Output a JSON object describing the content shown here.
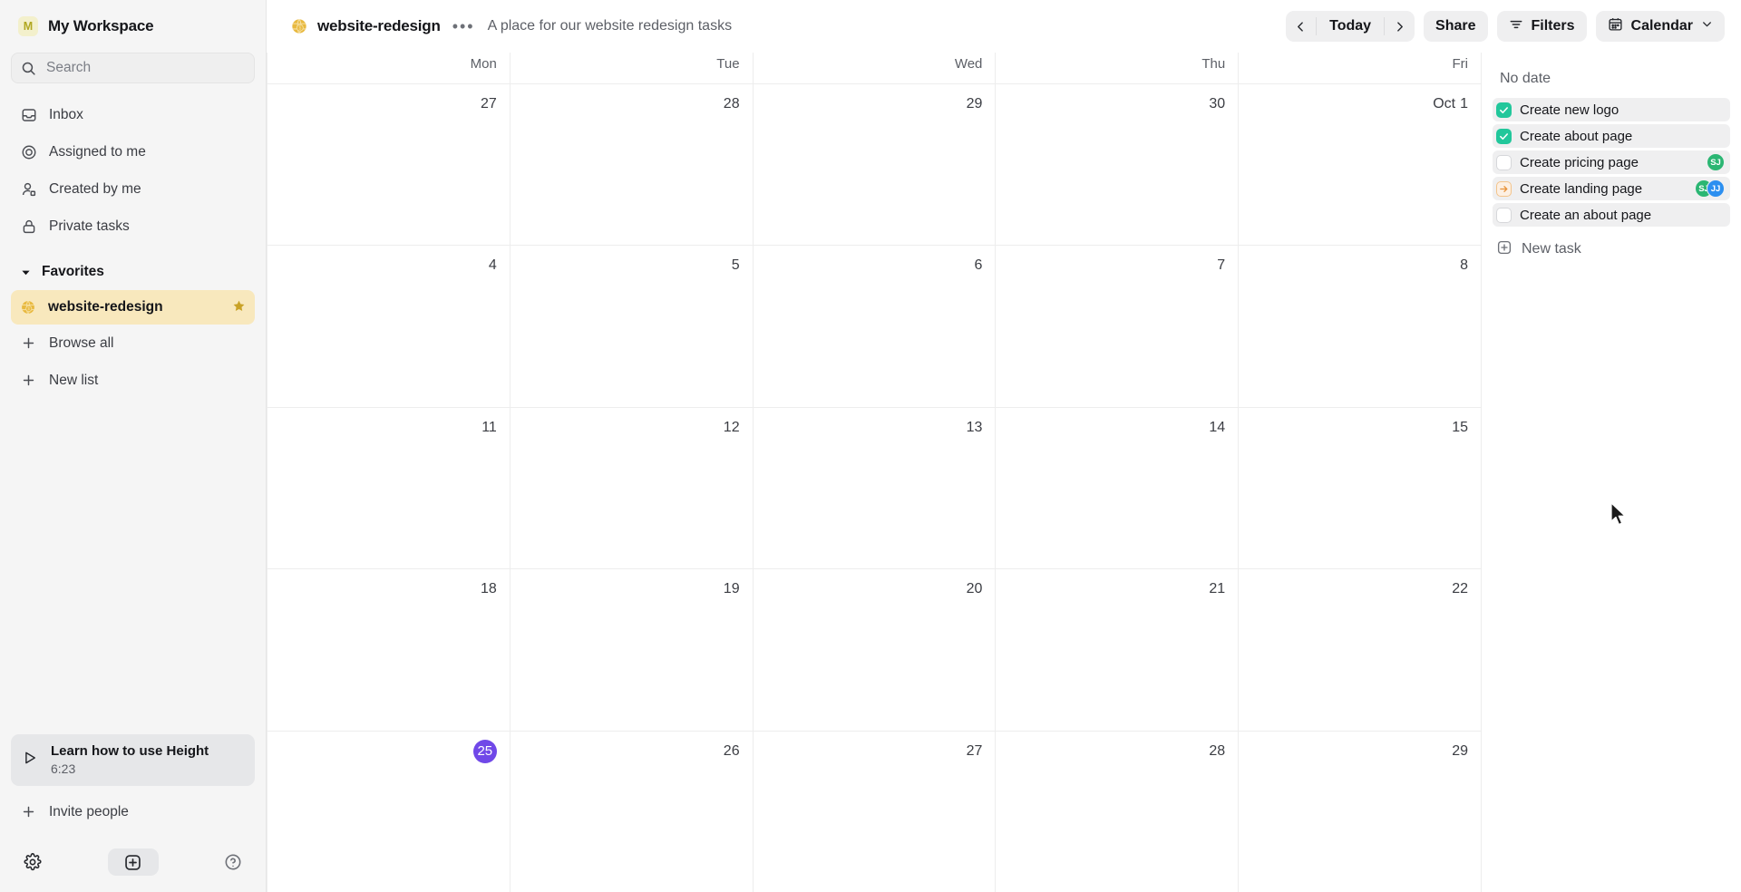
{
  "sidebar": {
    "workspace": {
      "avatar_initial": "M",
      "name": "My Workspace",
      "avatar_bg": "#f3f0cc",
      "avatar_fg": "#b0a721"
    },
    "search": {
      "placeholder": "Search",
      "value": "",
      "icon": "search-icon"
    },
    "nav": [
      {
        "icon": "inbox-icon",
        "label": "Inbox"
      },
      {
        "icon": "target-icon",
        "label": "Assigned to me"
      },
      {
        "icon": "user-icon",
        "label": "Created by me"
      },
      {
        "icon": "lock-icon",
        "label": "Private tasks"
      }
    ],
    "favorites": {
      "caret": "chevron-down-icon",
      "title": "Favorites"
    },
    "favorite_items": [
      {
        "icon": "globe-icon",
        "name": "website-redesign",
        "starred": true,
        "star_icon": "star-icon",
        "active": true
      }
    ],
    "actions": [
      {
        "icon": "plus-icon",
        "label": "Browse all"
      },
      {
        "icon": "plus-icon",
        "label": "New list"
      }
    ],
    "learn_card": {
      "icon": "play-icon",
      "title": "Learn how to use Height",
      "duration": "6:23"
    },
    "invite": {
      "icon": "plus-icon",
      "label": "Invite people"
    },
    "bottom": {
      "settings_icon": "gear-icon",
      "add_icon": "plus-square-icon",
      "help_icon": "help-circle-icon"
    }
  },
  "topbar": {
    "doc_icon": "globe-icon",
    "title": "website-redesign",
    "more_label": "•••",
    "description": "A place for our website redesign tasks",
    "nav": {
      "prev_icon": "chevron-left-icon",
      "today_label": "Today",
      "next_icon": "chevron-right-icon"
    },
    "share_label": "Share",
    "filters": {
      "icon": "filter-icon",
      "label": "Filters"
    },
    "view": {
      "icon": "calendar-icon",
      "label": "Calendar",
      "caret": "chevron-down-icon"
    }
  },
  "calendar": {
    "weekday_headers": [
      "Mon",
      "Tue",
      "Wed",
      "Thu",
      "Fri"
    ],
    "today_color": "#7048e8",
    "weeks": [
      [
        {
          "day": "27",
          "month": ""
        },
        {
          "day": "28",
          "month": ""
        },
        {
          "day": "29",
          "month": ""
        },
        {
          "day": "30",
          "month": ""
        },
        {
          "day": "1",
          "month": "Oct"
        }
      ],
      [
        {
          "day": "4",
          "month": ""
        },
        {
          "day": "5",
          "month": ""
        },
        {
          "day": "6",
          "month": ""
        },
        {
          "day": "7",
          "month": ""
        },
        {
          "day": "8",
          "month": ""
        }
      ],
      [
        {
          "day": "11",
          "month": ""
        },
        {
          "day": "12",
          "month": ""
        },
        {
          "day": "13",
          "month": ""
        },
        {
          "day": "14",
          "month": ""
        },
        {
          "day": "15",
          "month": ""
        }
      ],
      [
        {
          "day": "18",
          "month": ""
        },
        {
          "day": "19",
          "month": ""
        },
        {
          "day": "20",
          "month": ""
        },
        {
          "day": "21",
          "month": ""
        },
        {
          "day": "22",
          "month": ""
        }
      ],
      [
        {
          "day": "25",
          "month": "",
          "today": true
        },
        {
          "day": "26",
          "month": ""
        },
        {
          "day": "27",
          "month": ""
        },
        {
          "day": "28",
          "month": ""
        },
        {
          "day": "29",
          "month": ""
        }
      ]
    ]
  },
  "right_panel": {
    "title": "No date",
    "tasks": [
      {
        "state": "done",
        "name": "Create new logo",
        "assignees": []
      },
      {
        "state": "done",
        "name": "Create about page",
        "assignees": []
      },
      {
        "state": "open",
        "name": "Create pricing page",
        "assignees": [
          {
            "initials": "SJ",
            "color": "#2bb673"
          }
        ]
      },
      {
        "state": "in-progress",
        "name": "Create landing page",
        "assignees": [
          {
            "initials": "SJ",
            "color": "#2bb673"
          },
          {
            "initials": "JJ",
            "color": "#2c8ff0"
          }
        ]
      },
      {
        "state": "open",
        "name": "Create an about page",
        "assignees": []
      }
    ],
    "new_task": {
      "icon": "plus-square-icon",
      "label": "New task"
    },
    "colors": {
      "done": "#22c79b",
      "in_progress_border": "#f3c48b",
      "in_progress_bg": "#fdf0e3"
    }
  }
}
